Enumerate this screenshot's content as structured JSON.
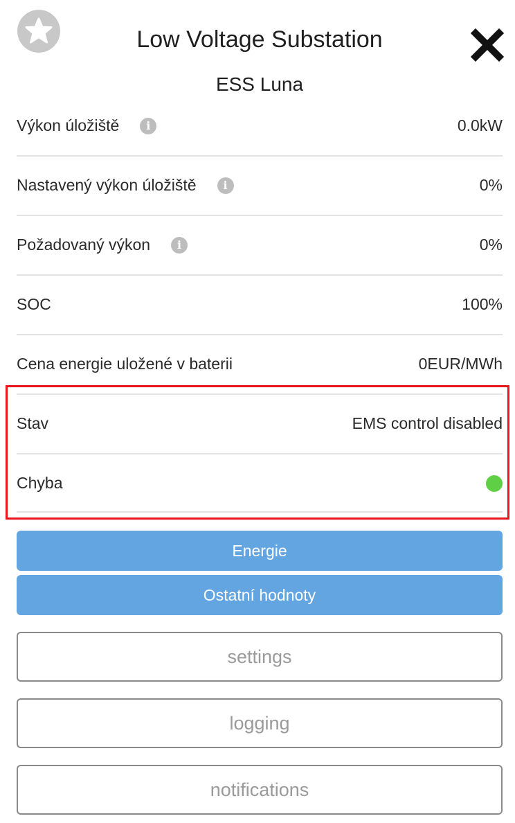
{
  "header": {
    "title": "Low Voltage Substation",
    "subtitle": "ESS Luna",
    "favorite_icon": "star-icon",
    "close_icon": "close-icon"
  },
  "rows": [
    {
      "label": "Výkon úložiště",
      "value": "0.0kW",
      "has_info": true
    },
    {
      "label": "Nastavený výkon úložiště",
      "value": "0%",
      "has_info": true
    },
    {
      "label": "Požadovaný výkon",
      "value": "0%",
      "has_info": true
    },
    {
      "label": "SOC",
      "value": "100%",
      "has_info": false
    },
    {
      "label": "Cena energie uložené v baterii",
      "value": "0EUR/MWh",
      "has_info": false
    }
  ],
  "status": {
    "stav_label": "Stav",
    "stav_value": "EMS control disabled",
    "chyba_label": "Chyba",
    "chyba_indicator_color": "#5fd046"
  },
  "buttons": {
    "energie": "Energie",
    "ostatni": "Ostatní hodnoty",
    "settings": "settings",
    "logging": "logging",
    "notifications": "notifications"
  },
  "info_icon_glyph": "i",
  "colors": {
    "accent_blue": "#63a5e0",
    "highlight_red": "#e8151b",
    "ok_green": "#5fd046"
  }
}
